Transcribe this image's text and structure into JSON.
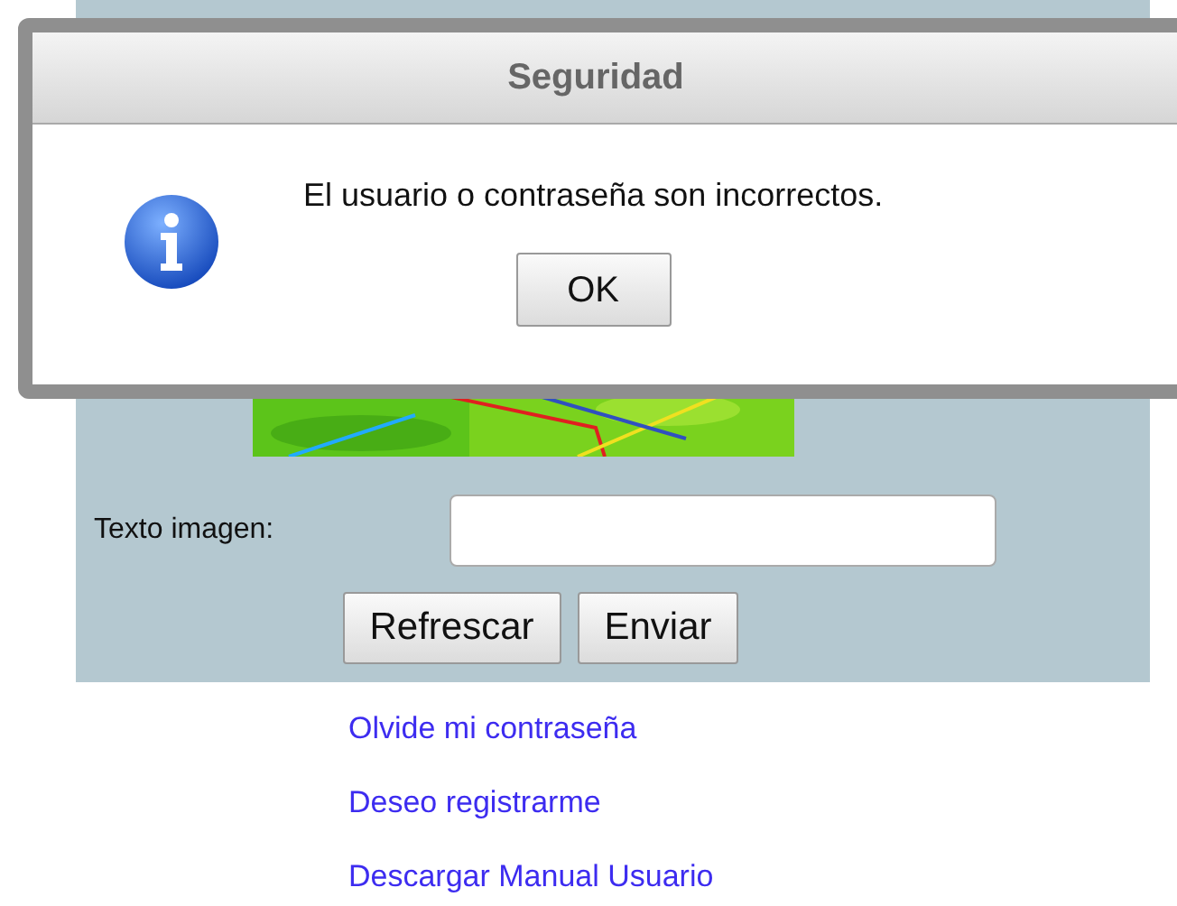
{
  "dialog": {
    "title": "Seguridad",
    "message": "El usuario o contraseña son incorrectos.",
    "button": "OK"
  },
  "form": {
    "captcha": {
      "kind": "picture"
    },
    "label": "Texto imagen:",
    "buttons": [
      "Refrescar",
      "Enviar"
    ]
  },
  "links": [
    "Olvide mi contraseña",
    "Deseo registrarme",
    "Descargar Manual Usuario"
  ]
}
